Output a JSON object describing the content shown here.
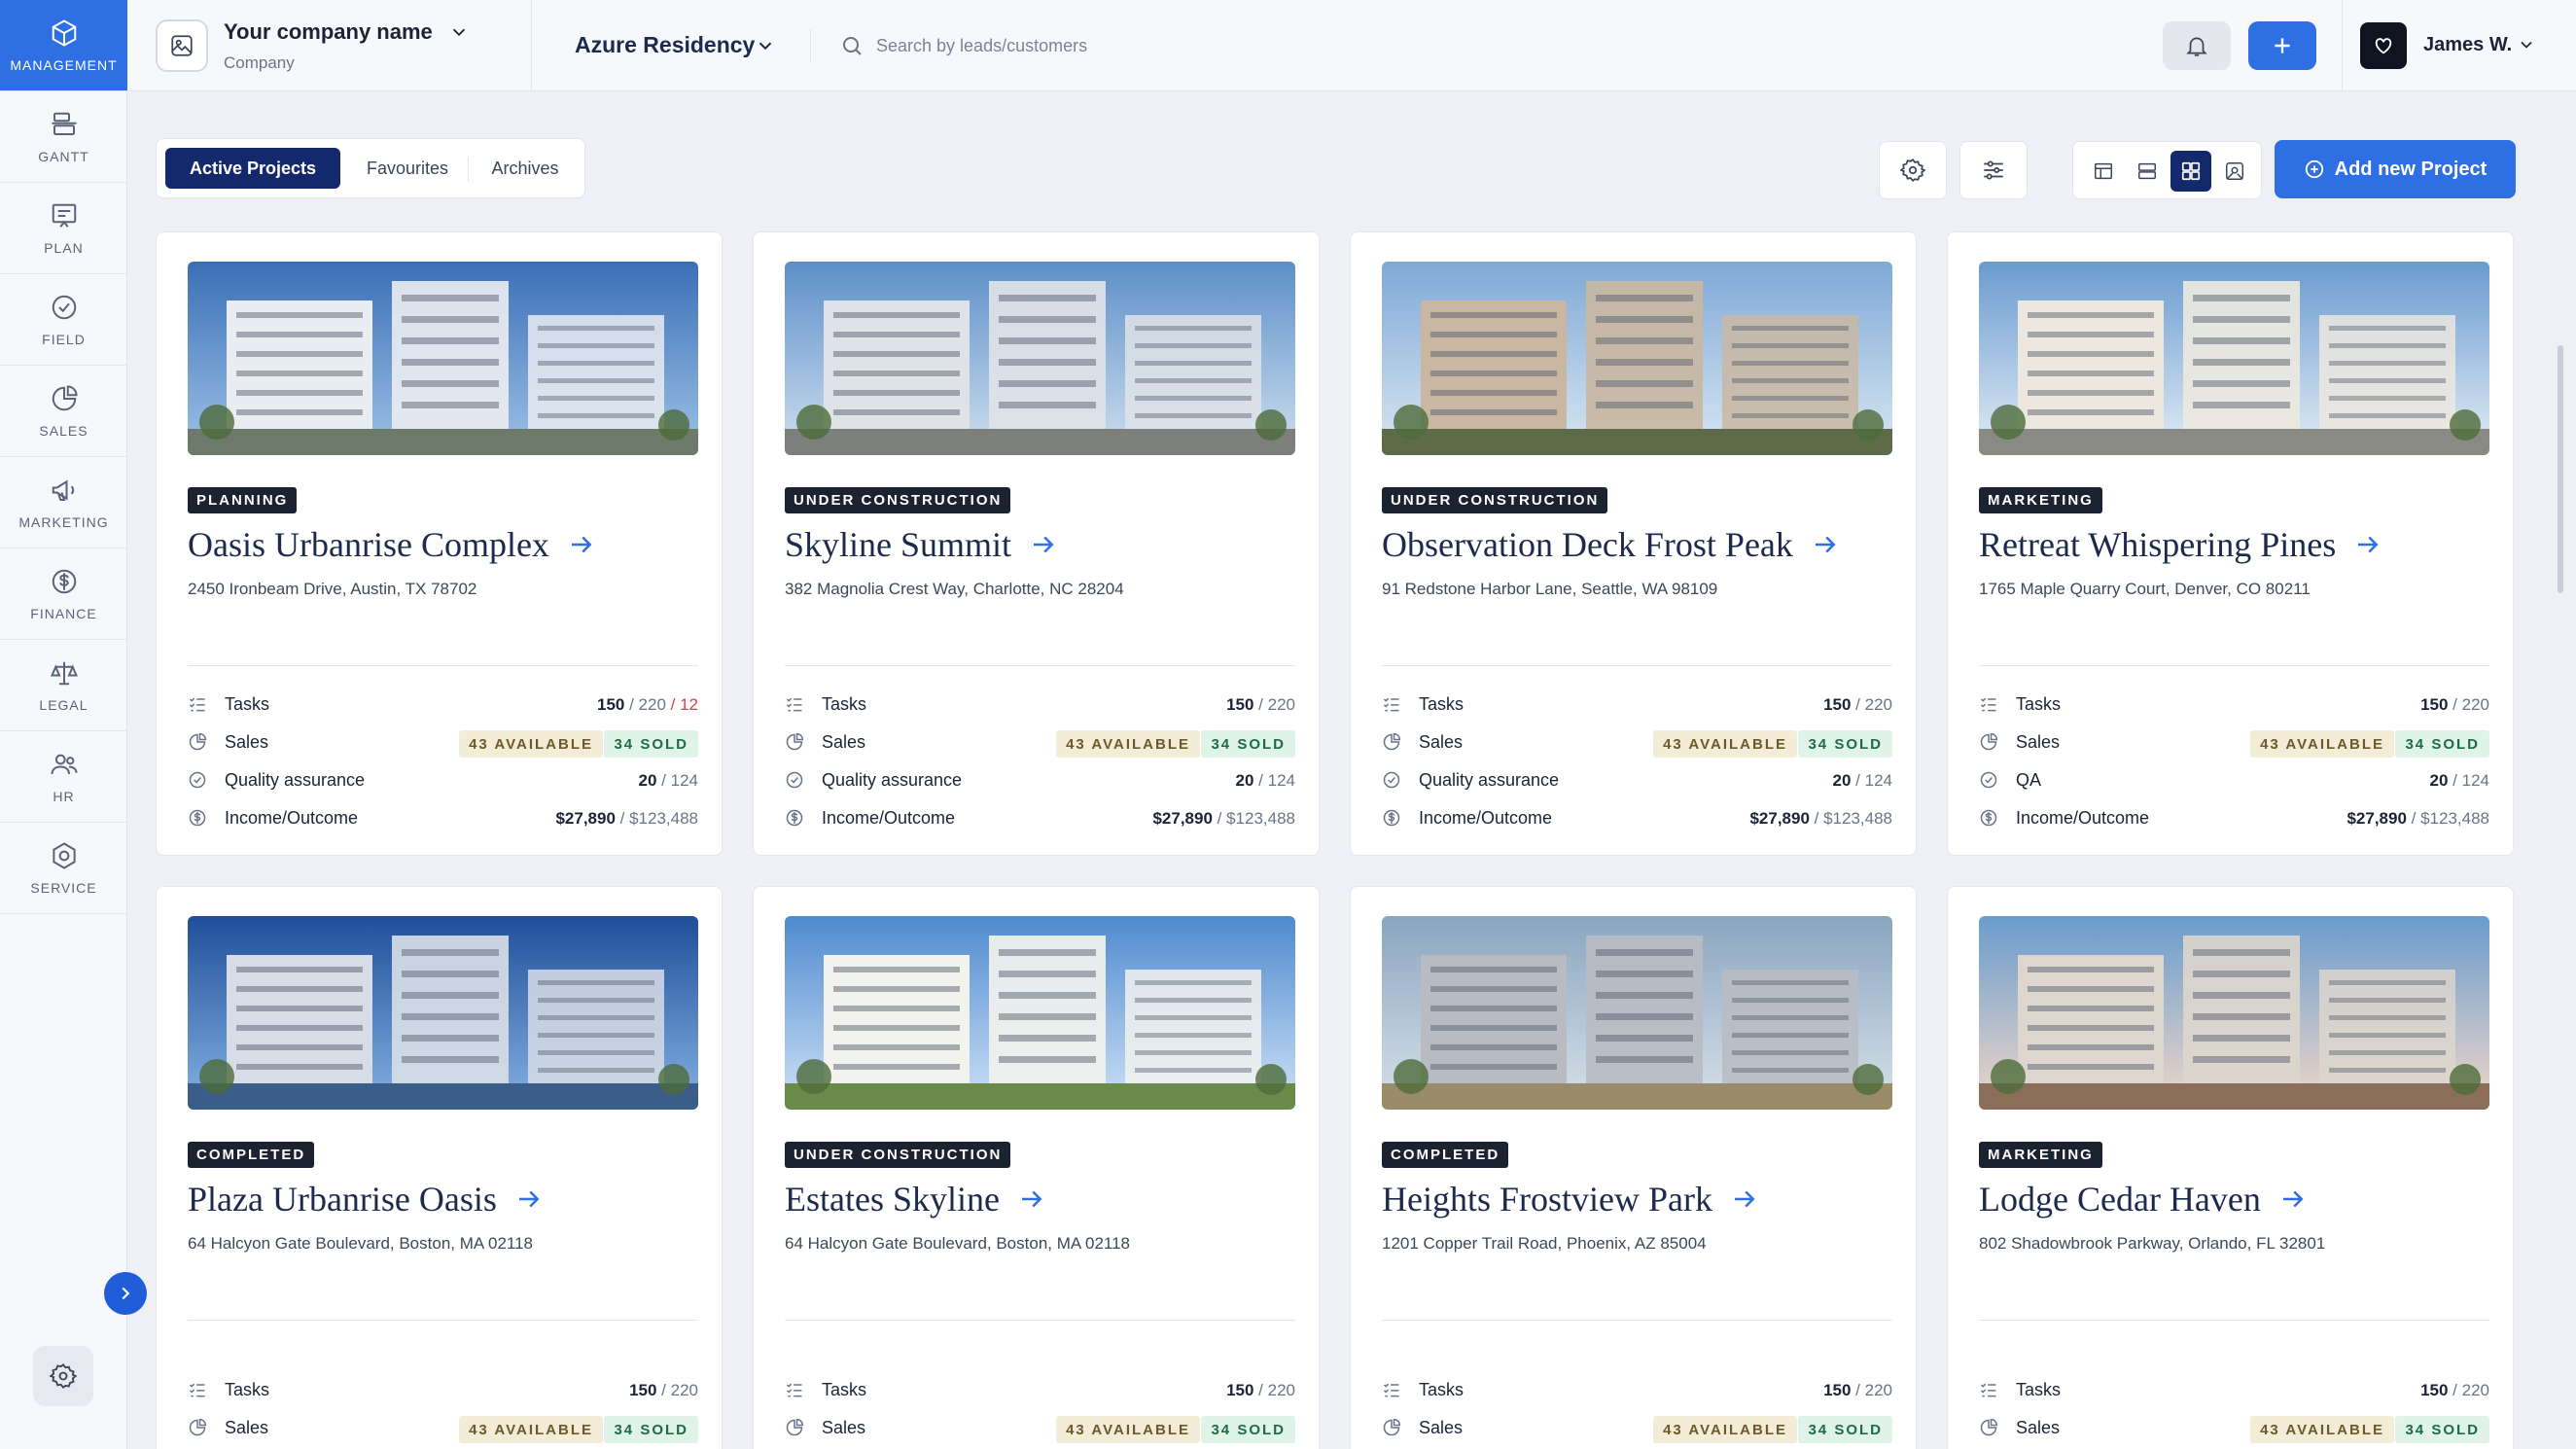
{
  "sidebar": {
    "items": [
      {
        "label": "MANAGEMENT",
        "icon": "cube-icon",
        "active": true
      },
      {
        "label": "GANTT",
        "icon": "gantt-icon"
      },
      {
        "label": "PLAN",
        "icon": "plan-icon"
      },
      {
        "label": "FIELD",
        "icon": "check-circle-icon"
      },
      {
        "label": "SALES",
        "icon": "pie-chart-icon"
      },
      {
        "label": "MARKETING",
        "icon": "megaphone-icon"
      },
      {
        "label": "FINANCE",
        "icon": "dollar-icon"
      },
      {
        "label": "LEGAL",
        "icon": "scales-icon"
      },
      {
        "label": "HR",
        "icon": "people-icon"
      },
      {
        "label": "SERVICE",
        "icon": "service-icon"
      }
    ]
  },
  "topbar": {
    "company_name": "Your company name",
    "company_sub": "Company",
    "project": "Azure Residency",
    "search_placeholder": "Search by leads/customers",
    "user_name": "James W."
  },
  "toolbar": {
    "tabs": [
      "Active Projects",
      "Favourites",
      "Archives"
    ],
    "active_tab": "Active Projects",
    "add_label": "Add new Project"
  },
  "colors": {
    "accent": "#2f6fe4",
    "navy": "#13296b",
    "badge": "#1b2230"
  },
  "projects": [
    {
      "status": "PLANNING",
      "title": "Oasis Urbanrise Complex",
      "address": "2450 Ironbeam Drive, Austin, TX 78702",
      "tasks_label": "Tasks",
      "tasks_done": "150",
      "tasks_total": " / 220",
      "tasks_extra": " / 12",
      "sales_label": "Sales",
      "available": "43 AVAILABLE",
      "sold": "34 SOLD",
      "qa_label": "Quality assurance",
      "qa_done": "20",
      "qa_total": " / 124",
      "income_label": "Income/Outcome",
      "income": "$27,890",
      "outcome": " / $123,488"
    },
    {
      "status": "UNDER CONSTRUCTION",
      "title": "Skyline Summit",
      "address": "382 Magnolia Crest Way, Charlotte, NC 28204",
      "tasks_label": "Tasks",
      "tasks_done": "150",
      "tasks_total": " / 220",
      "tasks_extra": "",
      "sales_label": "Sales",
      "available": "43 AVAILABLE",
      "sold": "34 SOLD",
      "qa_label": "Quality assurance",
      "qa_done": "20",
      "qa_total": " / 124",
      "income_label": "Income/Outcome",
      "income": "$27,890",
      "outcome": " / $123,488"
    },
    {
      "status": "UNDER CONSTRUCTION",
      "title": "Observation Deck Frost Peak",
      "address": "91 Redstone Harbor Lane, Seattle, WA 98109",
      "tasks_label": "Tasks",
      "tasks_done": "150",
      "tasks_total": " / 220",
      "tasks_extra": "",
      "sales_label": "Sales",
      "available": "43 AVAILABLE",
      "sold": "34 SOLD",
      "qa_label": "Quality assurance",
      "qa_done": "20",
      "qa_total": " / 124",
      "income_label": "Income/Outcome",
      "income": "$27,890",
      "outcome": " / $123,488"
    },
    {
      "status": "MARKETING",
      "title": "Retreat Whispering Pines",
      "address": "1765 Maple Quarry Court, Denver, CO 80211",
      "tasks_label": "Tasks",
      "tasks_done": "150",
      "tasks_total": " / 220",
      "tasks_extra": "",
      "sales_label": "Sales",
      "available": "43 AVAILABLE",
      "sold": "34 SOLD",
      "qa_label": "QA",
      "qa_done": "20",
      "qa_total": " / 124",
      "income_label": "Income/Outcome",
      "income": "$27,890",
      "outcome": " / $123,488"
    },
    {
      "status": "COMPLETED",
      "title": "Plaza Urbanrise Oasis",
      "address": "64 Halcyon Gate Boulevard, Boston, MA 02118",
      "tasks_label": "Tasks",
      "tasks_done": "150",
      "tasks_total": " / 220",
      "tasks_extra": "",
      "sales_label": "Sales",
      "available": "43 AVAILABLE",
      "sold": "34 SOLD"
    },
    {
      "status": "UNDER CONSTRUCTION",
      "title": "Estates Skyline",
      "address": "64 Halcyon Gate Boulevard, Boston, MA 02118",
      "tasks_label": "Tasks",
      "tasks_done": "150",
      "tasks_total": " / 220",
      "tasks_extra": "",
      "sales_label": "Sales",
      "available": "43 AVAILABLE",
      "sold": "34 SOLD"
    },
    {
      "status": "COMPLETED",
      "title": "Heights Frostview Park",
      "address": "1201 Copper Trail Road, Phoenix, AZ 85004",
      "tasks_label": "Tasks",
      "tasks_done": "150",
      "tasks_total": " / 220",
      "tasks_extra": "",
      "sales_label": "Sales",
      "available": "43 AVAILABLE",
      "sold": "34 SOLD"
    },
    {
      "status": "MARKETING",
      "title": "Lodge Cedar Haven",
      "address": "802 Shadowbrook Parkway, Orlando, FL 32801",
      "tasks_label": "Tasks",
      "tasks_done": "150",
      "tasks_total": " / 220",
      "tasks_extra": "",
      "sales_label": "Sales",
      "available": "43 AVAILABLE",
      "sold": "34 SOLD"
    }
  ]
}
